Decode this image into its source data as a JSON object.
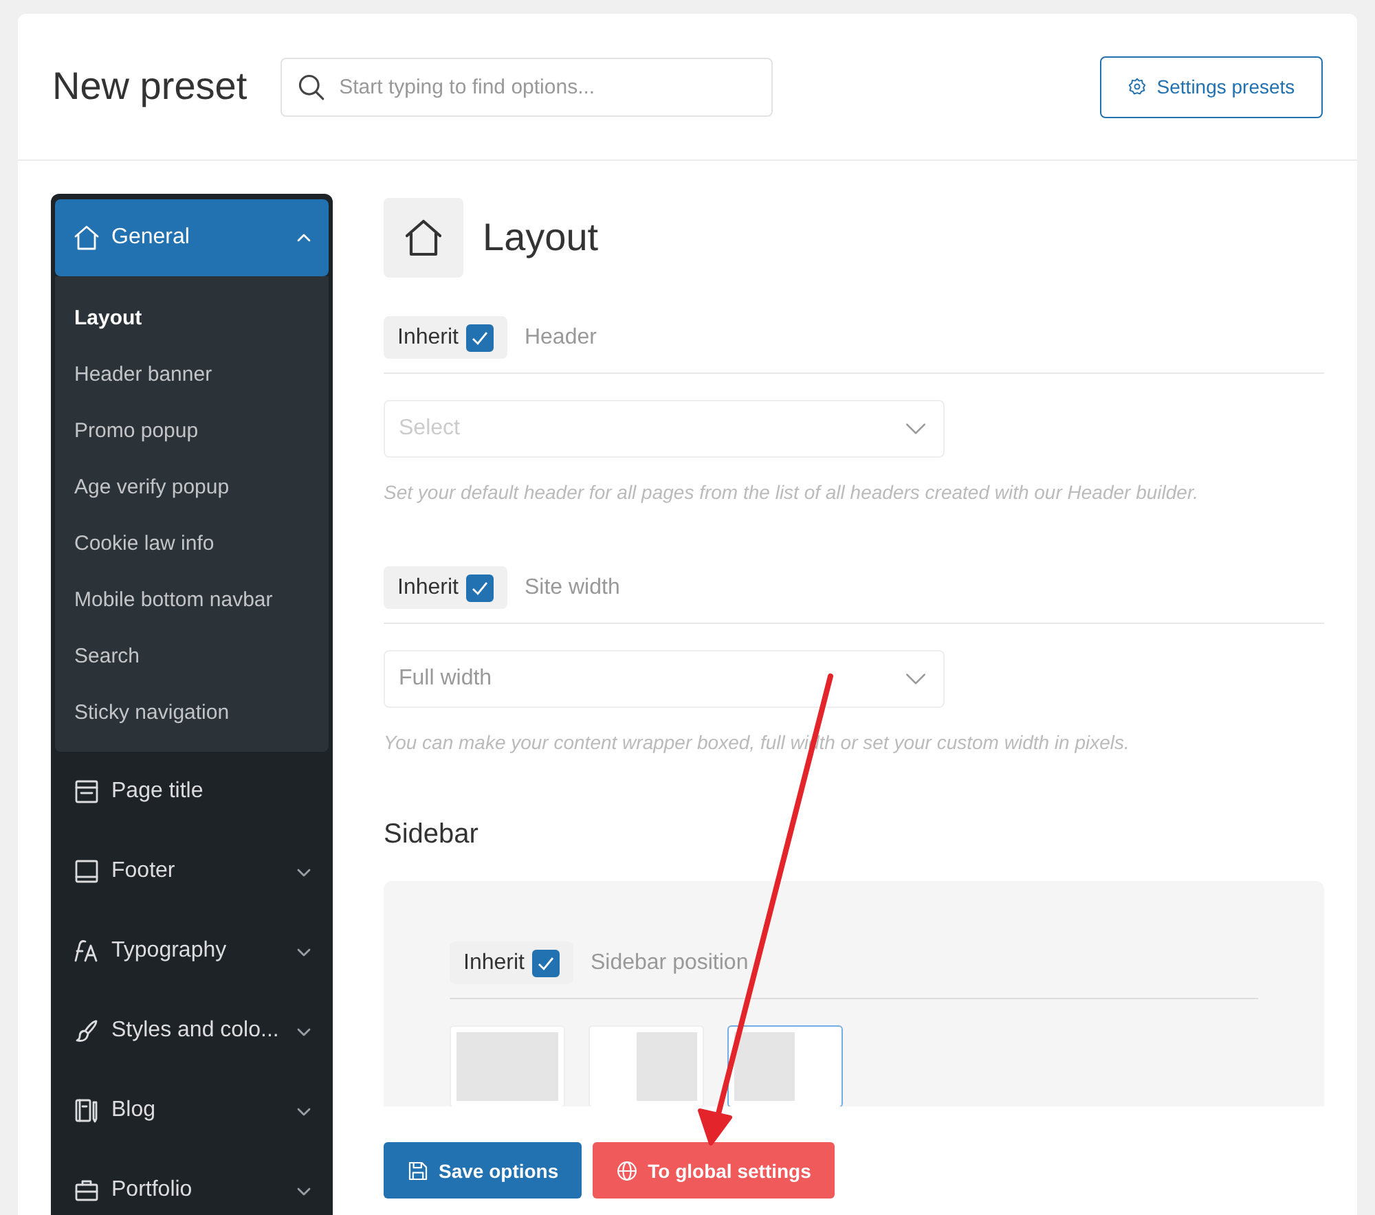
{
  "header": {
    "title": "New preset",
    "search": {
      "placeholder": "Start typing to find options..."
    },
    "presets_button": "Settings presets"
  },
  "sidebar": {
    "items": [
      {
        "label": "General",
        "expanded": true,
        "selected": true,
        "children": [
          {
            "label": "Layout",
            "selected": true
          },
          {
            "label": "Header banner",
            "selected": false
          },
          {
            "label": "Promo popup",
            "selected": false
          },
          {
            "label": "Age verify popup",
            "selected": false
          },
          {
            "label": "Cookie law info",
            "selected": false
          },
          {
            "label": "Mobile bottom navbar",
            "selected": false
          },
          {
            "label": "Search",
            "selected": false
          },
          {
            "label": "Sticky navigation",
            "selected": false
          }
        ]
      },
      {
        "label": "Page title",
        "selected": false
      },
      {
        "label": "Footer",
        "expanded": false,
        "selected": false
      },
      {
        "label": "Typography",
        "expanded": false,
        "selected": false
      },
      {
        "label": "Styles and colo...",
        "expanded": false,
        "selected": false
      },
      {
        "label": "Blog",
        "expanded": false,
        "selected": false
      },
      {
        "label": "Portfolio",
        "expanded": false,
        "selected": false
      }
    ]
  },
  "content": {
    "title": "Layout",
    "sections": [
      {
        "kind": "option",
        "inherit": {
          "label": "Inherit",
          "checked": true
        },
        "label": "Header",
        "placeholder": "Select",
        "hint": "Set your default header for all pages from the list of all headers created with our Header builder."
      },
      {
        "kind": "option",
        "inherit": {
          "label": "Inherit",
          "checked": true
        },
        "label": "Site width",
        "value": "Full width",
        "hint": "You can make your content wrapper boxed, full width or set your custom width in pixels."
      },
      {
        "kind": "heading",
        "label": "Sidebar"
      },
      {
        "kind": "panel",
        "inherit": {
          "label": "Inherit",
          "checked": true
        },
        "label": "Sidebar position",
        "choices": [
          {
            "selected": false
          },
          {
            "selected": false
          },
          {
            "selected": true
          }
        ]
      }
    ]
  },
  "footer": {
    "buttons": [
      {
        "kind": "save",
        "label": "Save options"
      },
      {
        "kind": "global",
        "label": "To global settings"
      }
    ]
  }
}
